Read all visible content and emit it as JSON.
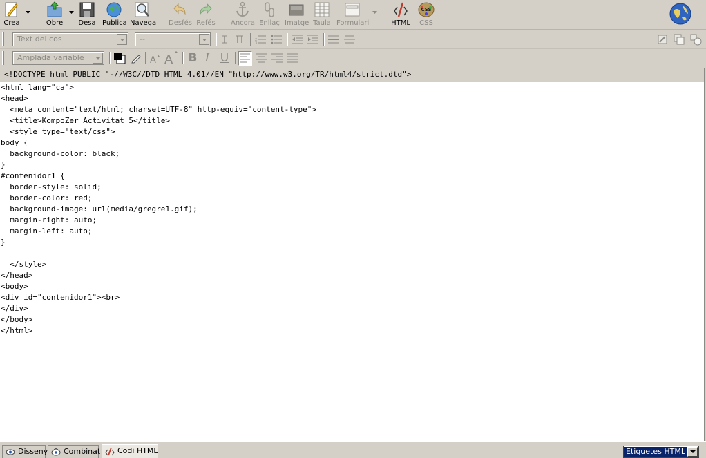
{
  "toolbar": {
    "crea": "Crea",
    "obre": "Obre",
    "desa": "Desa",
    "publica": "Publica",
    "navega": "Navega",
    "desfes": "Desfés",
    "refes": "Refés",
    "ancora": "Àncora",
    "enllac": "Enllaç",
    "imatge": "Imatge",
    "taula": "Taula",
    "formulari": "Formulari",
    "html": "HTML",
    "css": "CSS"
  },
  "format": {
    "paragraph_style": "Text del cos",
    "font_size": "--",
    "font_face": "Amplada variable"
  },
  "editor": {
    "doctype": "<!DOCTYPE html PUBLIC \"-//W3C//DTD HTML 4.01//EN \"http://www.w3.org/TR/html4/strict.dtd\">",
    "lines": [
      "<html lang=\"ca\">",
      "<head>",
      "  <meta content=\"text/html; charset=UTF-8\" http-equiv=\"content-type\">",
      "  <title>KompoZer Activitat 5</title>",
      "  <style type=\"text/css\">",
      "body {",
      "  background-color: black;",
      "}",
      "#contenidor1 {",
      "  border-style: solid;",
      "  border-color: red;",
      "  background-image: url(media/gregre1.gif);",
      "  margin-right: auto;",
      "  margin-left: auto;",
      "}",
      "",
      "  </style>",
      "</head>",
      "<body>",
      "<div id=\"contenidor1\"><br>",
      "</div>",
      "</body>",
      "</html>"
    ]
  },
  "bottom": {
    "tabs": [
      "Disseny",
      "Combinat",
      "Codi HTML"
    ],
    "active_tab": "Codi HTML",
    "tag_selector": "Etiquetes HTML"
  },
  "colors": {
    "chrome": "#d4d0c8",
    "text_color_swatch": "#000000",
    "selection": "#0a246a"
  }
}
